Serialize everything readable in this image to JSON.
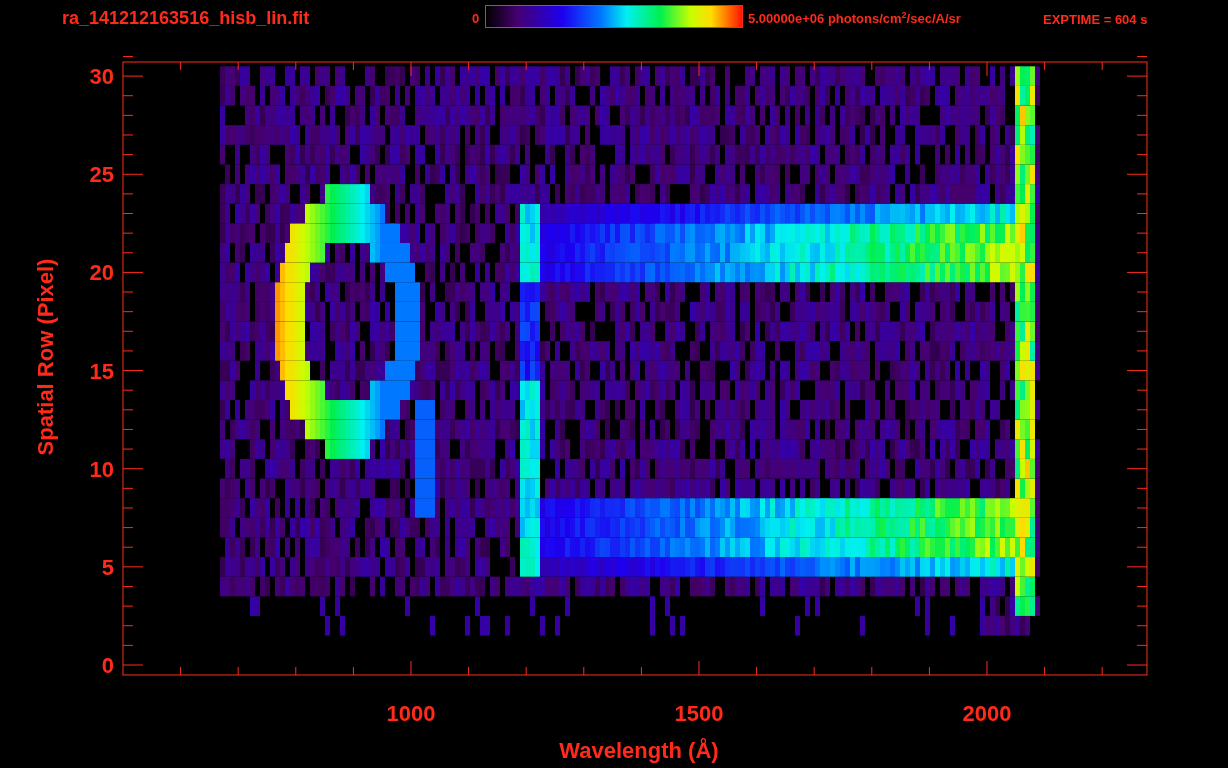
{
  "plot": {
    "title": "ra_141212163516_hisb_lin.fit",
    "colorbar": {
      "min_label": "0",
      "max_label": "5.00000e+06 photons/cm$^{2}$/sec/A/sr"
    },
    "exptime": "EXPTIME = 604 s",
    "xlabel": "Wavelength (Å)",
    "ylabel": "Spatial Row (Pixel)",
    "xtick_labels": [
      "1000",
      "1500",
      "2000"
    ],
    "ytick_labels": [
      "30",
      "25",
      "20",
      "15",
      "10",
      "5",
      "0"
    ]
  }
}
